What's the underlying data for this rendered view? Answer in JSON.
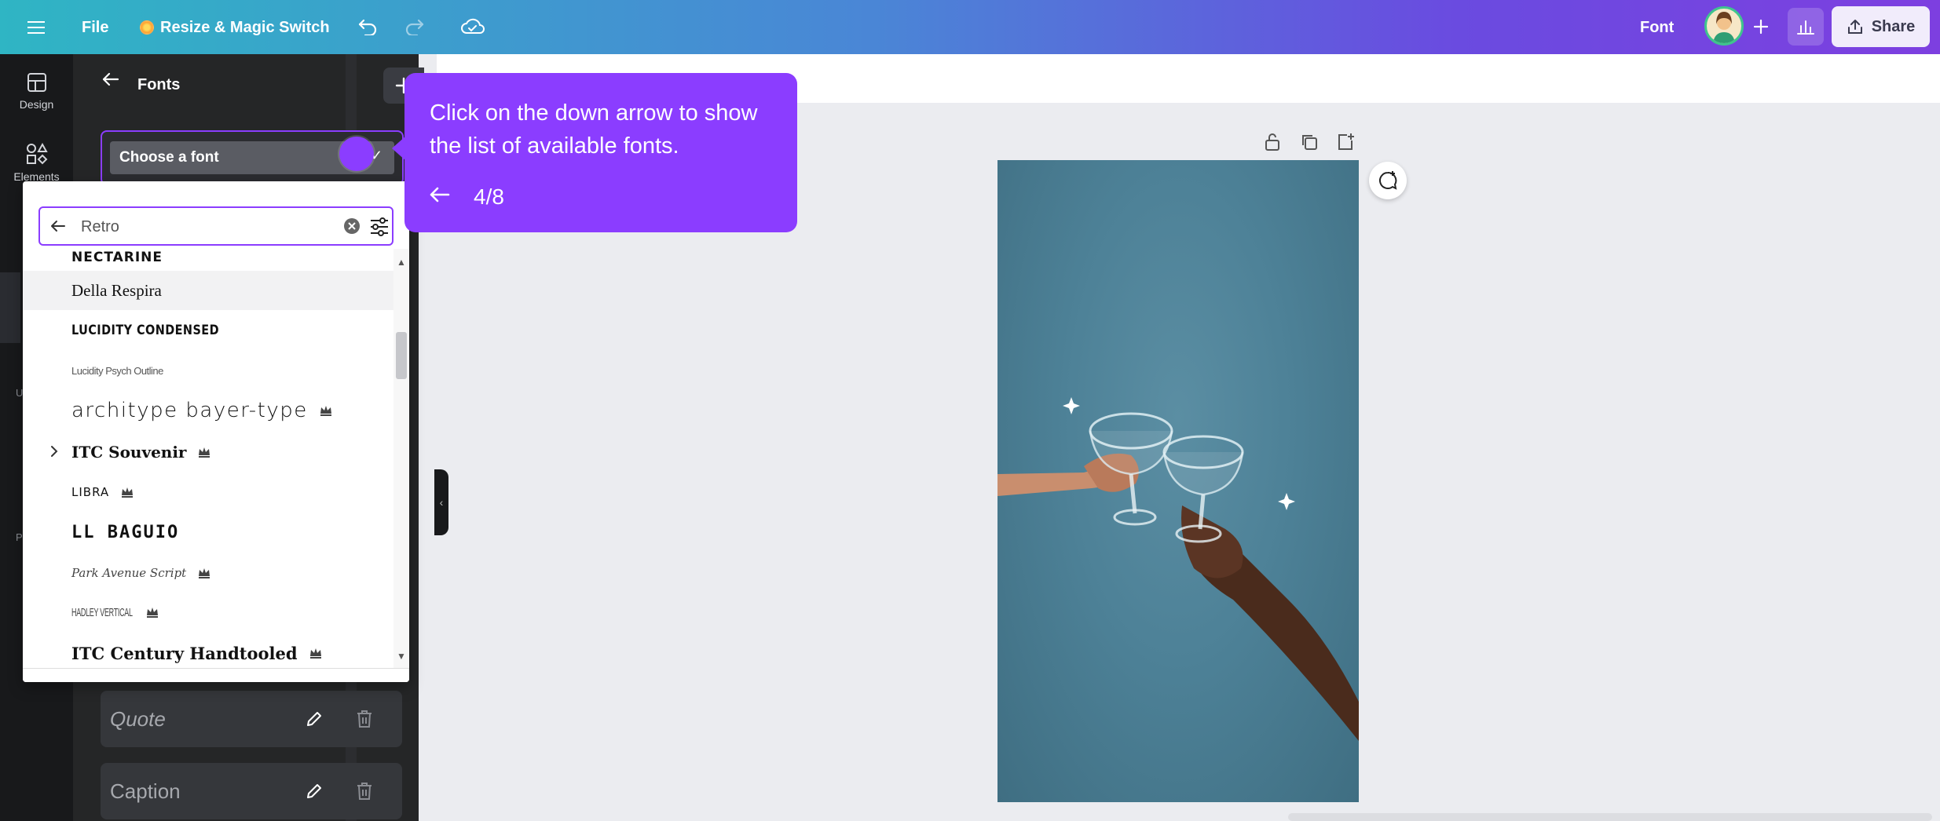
{
  "topbar": {
    "file_label": "File",
    "resize_label": "Resize & Magic Switch",
    "font_label": "Font",
    "share_label": "Share",
    "icons": [
      "menu-icon",
      "undo-icon",
      "redo-icon",
      "cloud-sync-icon",
      "plus-icon",
      "analytics-icon",
      "share-icon"
    ]
  },
  "rail": {
    "items": [
      {
        "label": "Design",
        "icon": "design-icon"
      },
      {
        "label": "Elements",
        "icon": "elements-icon"
      }
    ],
    "stubs": [
      "U",
      "P"
    ]
  },
  "panel": {
    "title": "Fonts",
    "choose_font_label": "Choose a font",
    "text_styles": [
      {
        "label": "Quote"
      },
      {
        "label": "Caption"
      }
    ]
  },
  "dropdown": {
    "search_value": "Retro",
    "fonts": [
      {
        "label": "NECTARINE",
        "premium": false
      },
      {
        "label": "Della Respira",
        "premium": false
      },
      {
        "label": "LUCIDITY CONDENSED",
        "premium": false
      },
      {
        "label": "Lucidity Psych Outline",
        "premium": false
      },
      {
        "label": "architype bayer-type",
        "premium": true
      },
      {
        "label": "ITC Souvenir",
        "premium": true
      },
      {
        "label": "LIBRA",
        "premium": true
      },
      {
        "label": "LL BAGUIO",
        "premium": false
      },
      {
        "label": "Park Avenue Script",
        "premium": true
      },
      {
        "label": "HADLEY VERTICAL",
        "premium": true
      },
      {
        "label": "ITC Century Handtooled",
        "premium": true
      }
    ]
  },
  "tooltip": {
    "text": "Click on the down arrow to show the list of available fonts.",
    "step": "4/8"
  },
  "colors": {
    "accent": "#8b3dff",
    "panel_bg": "#252627",
    "rail_bg": "#18191b",
    "canvas_bg": "#ebecf0",
    "photo_bg": "#4d8197"
  }
}
